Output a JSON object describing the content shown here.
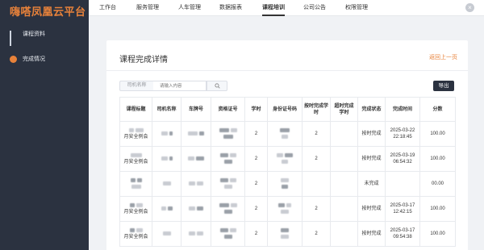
{
  "app": {
    "title": "嗨嗒凤凰云平台"
  },
  "sidebar": {
    "items": [
      {
        "label": "课程资料",
        "icon": "bar-chart-icon"
      },
      {
        "label": "完成情况",
        "icon": "circle-icon"
      }
    ]
  },
  "topnav": {
    "items": [
      {
        "label": "工作台"
      },
      {
        "label": "服务管理"
      },
      {
        "label": "人车管理"
      },
      {
        "label": "数据报表"
      },
      {
        "label": "课程培训",
        "active": true
      },
      {
        "label": "公司公告"
      },
      {
        "label": "权限管理"
      }
    ]
  },
  "page": {
    "title": "课程完成详情",
    "back_label": "返回上一页"
  },
  "search": {
    "label": "司机名称",
    "placeholder": "请输入内容"
  },
  "toolbar": {
    "export_label": "导出"
  },
  "table": {
    "headers": [
      "课程标题",
      "司机名称",
      "车牌号",
      "资格证号",
      "学时",
      "身份证号码",
      "按时完成学时",
      "超时完成学时",
      "完成状态",
      "完成时间",
      "分数"
    ],
    "rows": [
      {
        "title_suffix": "月安全例会",
        "hours": "2",
        "ontime": "2",
        "overtime": "",
        "status": "按时完成",
        "time": "2025-03-22 22:18:45",
        "score": "100.00"
      },
      {
        "title_suffix": "月安全例会",
        "hours": "2",
        "ontime": "2",
        "overtime": "",
        "status": "按时完成",
        "time": "2025-03-19 06:54:32",
        "score": "100.00"
      },
      {
        "title_suffix": "",
        "hours": "2",
        "ontime": "",
        "overtime": "",
        "status": "未完成",
        "time": "",
        "score": "00.00"
      },
      {
        "title_suffix": "月安全例会",
        "hours": "2",
        "ontime": "2",
        "overtime": "",
        "status": "按时完成",
        "time": "2025-03-17 12:42:15",
        "score": "100.00"
      },
      {
        "title_suffix": "月安全例会",
        "hours": "2",
        "ontime": "2",
        "overtime": "",
        "status": "按时完成",
        "time": "2025-03-17 09:54:38",
        "score": "100.00"
      }
    ]
  },
  "colors": {
    "sidebar_bg": "#2b3240",
    "accent": "#e8823a",
    "page_bg": "#f0f2f5"
  }
}
